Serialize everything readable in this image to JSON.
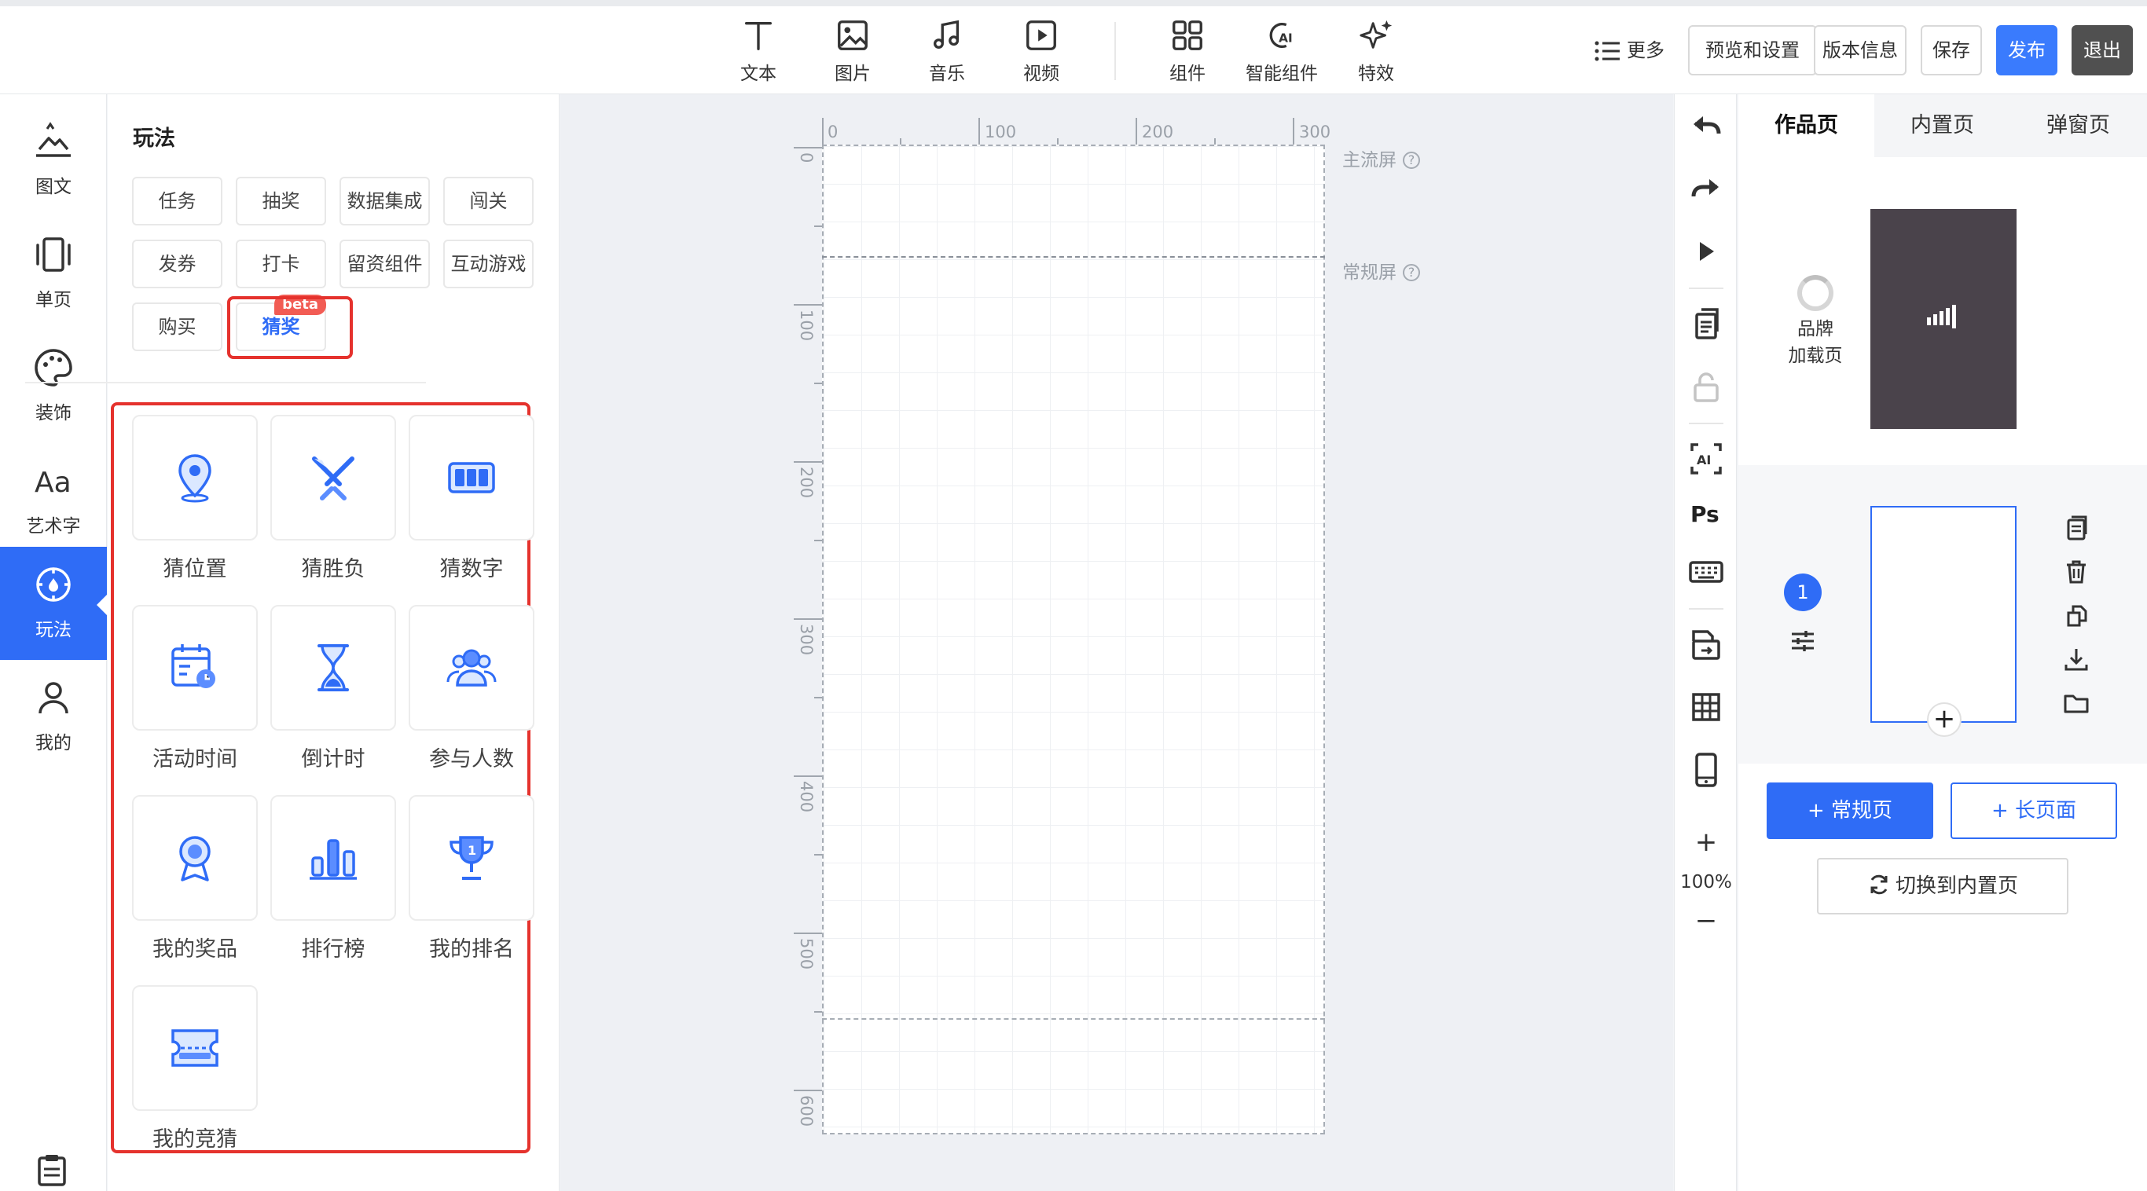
{
  "toolbar": {
    "items": [
      {
        "label": "文本",
        "icon": "text-icon"
      },
      {
        "label": "图片",
        "icon": "image-icon"
      },
      {
        "label": "音乐",
        "icon": "music-icon"
      },
      {
        "label": "视频",
        "icon": "video-icon"
      },
      {
        "label": "组件",
        "icon": "components-icon"
      },
      {
        "label": "智能组件",
        "icon": "ai-components-icon"
      },
      {
        "label": "特效",
        "icon": "sparkle-icon"
      }
    ],
    "more_label": "更多",
    "buttons": {
      "preview": "预览和设置",
      "version": "版本信息",
      "save": "保存",
      "publish": "发布",
      "exit": "退出"
    }
  },
  "rail": {
    "items": [
      {
        "label": "图文",
        "icon": "image-text-icon"
      },
      {
        "label": "单页",
        "icon": "single-page-icon"
      },
      {
        "label": "装饰",
        "icon": "palette-icon"
      },
      {
        "label": "艺术字",
        "icon": "art-text-icon"
      },
      {
        "label": "玩法",
        "icon": "gameplay-icon",
        "active": true
      },
      {
        "label": "我的",
        "icon": "user-icon"
      }
    ]
  },
  "panel": {
    "title": "玩法",
    "categories": [
      "任务",
      "抽奖",
      "数据集成",
      "闯关",
      "发券",
      "打卡",
      "留资组件",
      "互动游戏",
      "购买",
      "猜奖"
    ],
    "beta_badge": "beta",
    "widgets": [
      {
        "label": "猜位置",
        "icon": "location-pin-icon"
      },
      {
        "label": "猜胜负",
        "icon": "crossed-swords-icon"
      },
      {
        "label": "猜数字",
        "icon": "number-display-icon"
      },
      {
        "label": "活动时间",
        "icon": "calendar-clock-icon"
      },
      {
        "label": "倒计时",
        "icon": "hourglass-icon"
      },
      {
        "label": "参与人数",
        "icon": "people-icon"
      },
      {
        "label": "我的奖品",
        "icon": "medal-icon"
      },
      {
        "label": "排行榜",
        "icon": "bar-chart-icon"
      },
      {
        "label": "我的排名",
        "icon": "trophy-icon"
      },
      {
        "label": "我的竞猜",
        "icon": "ticket-icon"
      }
    ]
  },
  "canvas": {
    "ruler_x": [
      "0",
      "100",
      "200",
      "300"
    ],
    "ruler_y": [
      "0",
      "100",
      "200",
      "300",
      "400",
      "500",
      "600"
    ],
    "main_screen_label": "主流屏",
    "regular_screen_label": "常规屏",
    "help_glyph": "?"
  },
  "right_tools": {
    "zoom": "100%",
    "zoom_in": "+",
    "zoom_out": "−"
  },
  "pages_panel": {
    "tabs": [
      "作品页",
      "内置页",
      "弹窗页"
    ],
    "brand_label_line1": "品牌",
    "brand_label_line2": "加载页",
    "page_number": "1",
    "add_glyph": "+",
    "btn_regular": "+ 常规页",
    "btn_long": "+ 长页面",
    "btn_switch": "切换到内置页"
  },
  "colors": {
    "accent": "#2f6cf6",
    "highlight": "#e5322d",
    "beta": "#f25c54"
  }
}
